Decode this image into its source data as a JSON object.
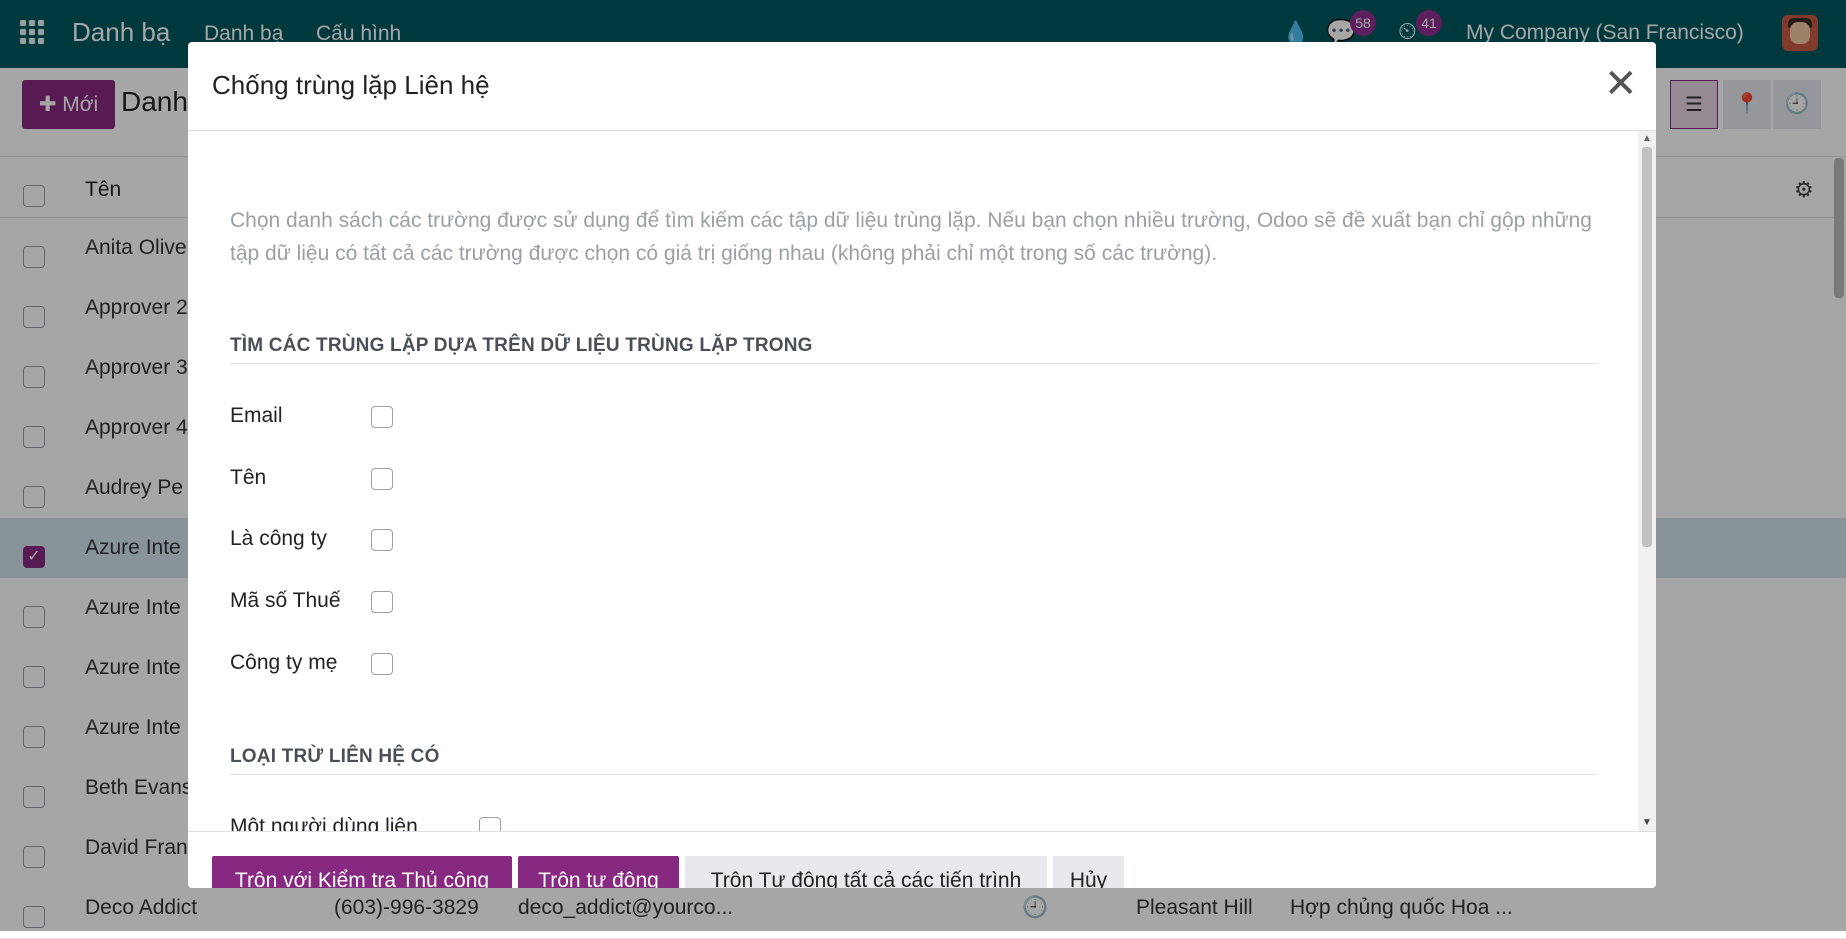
{
  "navbar": {
    "app_title": "Danh bạ",
    "menu": [
      "Danh bạ",
      "Cấu hình"
    ],
    "messages_count": "58",
    "activities_count": "41",
    "company": "My Company (San Francisco)"
  },
  "control": {
    "new_label": "Mới",
    "page_title": "Danh"
  },
  "list": {
    "header_name": "Tên",
    "rows": [
      {
        "name": "Anita Olive",
        "checked": false
      },
      {
        "name": "Approver 2",
        "checked": false
      },
      {
        "name": "Approver 3",
        "checked": false
      },
      {
        "name": "Approver 4",
        "checked": false
      },
      {
        "name": "Audrey Pe",
        "checked": false
      },
      {
        "name": "Azure Inte",
        "checked": true
      },
      {
        "name": "Azure Inte",
        "checked": false
      },
      {
        "name": "Azure Inte",
        "checked": false
      },
      {
        "name": "Azure Inte",
        "checked": false
      },
      {
        "name": "Beth Evans",
        "checked": false
      },
      {
        "name": "David Fran",
        "checked": false
      },
      {
        "name": "Deco Addict",
        "phone": "(603)-996-3829",
        "email": "deco_addict@yourco...",
        "city": "Pleasant Hill",
        "country": "Hợp chủng quốc Hoa ...",
        "checked": false
      }
    ]
  },
  "modal": {
    "title": "Chống trùng lặp Liên hệ",
    "intro": "Chọn danh sách các trường được sử dụng để tìm kiếm các tập dữ liệu trùng lặp. Nếu bạn chọn nhiều trường, Odoo sẽ đề xuất bạn chỉ gộp những tập dữ liệu có tất cả các trường được chọn có giá trị giống nhau (không phải chỉ một trong số các trường).",
    "section1": "TÌM CÁC TRÙNG LẶP DỰA TRÊN DỮ LIỆU TRÙNG LẶP TRONG",
    "fields": [
      "Email",
      "Tên",
      "Là công ty",
      "Mã số Thuế",
      "Công ty mẹ"
    ],
    "section2": "LOẠI TRỪ LIÊN HỆ CÓ",
    "exclude_field": "Một người dùng liên",
    "buttons": {
      "manual": "Trộn với Kiểm tra Thủ công",
      "auto": "Trộn tự động",
      "auto_all": "Trộn Tự động tất cả các tiến trình",
      "cancel": "Hủy"
    }
  }
}
